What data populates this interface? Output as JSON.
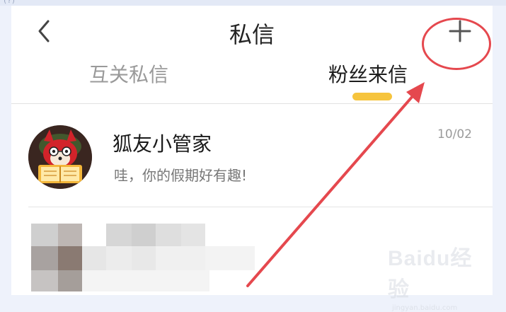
{
  "header": {
    "title": "私信",
    "back_icon": "chevron-left-icon",
    "add_icon": "plus-icon"
  },
  "tabs": [
    {
      "label": "互关私信",
      "active": false
    },
    {
      "label": "粉丝来信",
      "active": true
    }
  ],
  "colors": {
    "accent": "#f6c43d",
    "annotation": "#e5484e",
    "active_tab": "#1d1d1d",
    "inactive_tab": "#9a9a9a"
  },
  "messages": [
    {
      "sender": "狐友小管家",
      "preview": "哇，你的假期好有趣!",
      "date": "10/02",
      "avatar_icon": "fox-reading-avatar"
    }
  ],
  "watermark": {
    "logo": "Baidu经验",
    "url": "jingyan.baidu.com"
  }
}
